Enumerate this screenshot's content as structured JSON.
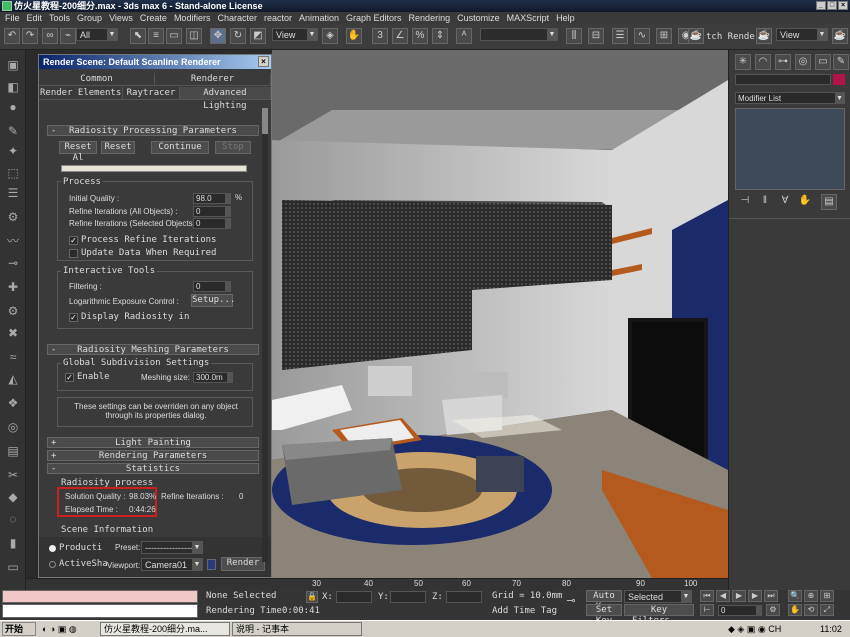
{
  "window": {
    "title": "仿火星教程-200细分.max - 3ds max 6 - Stand-alone License"
  },
  "menubar": {
    "items": [
      "File",
      "Edit",
      "Tools",
      "Group",
      "Views",
      "Create",
      "Modifiers",
      "Character",
      "reactor",
      "Animation",
      "Graph Editors",
      "Rendering",
      "Customize",
      "MAXScript",
      "Help"
    ]
  },
  "toolbar": {
    "selection_filter": "All",
    "ref_coord": "View",
    "render_label": "tch Render",
    "render_view": "View"
  },
  "dialog": {
    "title": "Render Scene: Default Scanline Renderer",
    "tabs_row1": [
      "Common",
      "Renderer"
    ],
    "tabs_row2": [
      "Render Elements",
      "Raytracer",
      "Advanced Lighting"
    ],
    "rollout_processing": "Radiosity Processing Parameters",
    "btn_reset_all": "Reset Al",
    "btn_reset": "Reset",
    "btn_continue": "Continue",
    "btn_stop": "Stop",
    "process_group": "Process",
    "initial_quality_label": "Initial Quality :",
    "initial_quality_value": "98.0",
    "initial_quality_unit": "%",
    "refine_all_label": "Refine Iterations (All Objects) :",
    "refine_all_value": "0",
    "refine_sel_label": "Refine Iterations (Selected Objects) :",
    "refine_sel_value": "0",
    "chk_process_refine": "Process Refine Iterations",
    "chk_update_data": "Update Data When Required",
    "interactive_group": "Interactive Tools",
    "filtering_label": "Filtering :",
    "filtering_value": "0",
    "log_exposure_label": "Logarithmic Exposure Control :",
    "setup_btn": "Setup...",
    "chk_display_radiosity": "Display Radiosity in",
    "rollout_meshing": "Radiosity Meshing Parameters",
    "global_subdiv": "Global Subdivision Settings",
    "chk_enable": "Enable",
    "meshing_size_label": "Meshing size:",
    "meshing_size_value": "300.0m",
    "override_note": "These settings can be overriden on any object through its properties dialog.",
    "rollout_light": "Light Painting",
    "rollout_rendering": "Rendering Parameters",
    "rollout_stats": "Statistics",
    "stats_group": "Radiosity process",
    "solution_quality_label": "Solution Quality :",
    "solution_quality_value": "98.03%",
    "refine_iter_label": "Refine Iterations :",
    "refine_iter_value": "0",
    "elapsed_label": "Elapsed Time :",
    "elapsed_value": "0:44:26",
    "scene_info": "Scene Information",
    "radio_production": "Producti",
    "radio_activeshade": "ActiveSha",
    "preset_label": "Preset:",
    "preset_value": "-------------------",
    "viewport_label": "Viewport:",
    "viewport_value": "Camera01",
    "render_btn": "Render"
  },
  "cmdpanel": {
    "modifier_list": "Modifier List"
  },
  "timeline": {
    "ticks": [
      "30",
      "40",
      "50",
      "60",
      "70",
      "80",
      "90",
      "100"
    ]
  },
  "status": {
    "selection": "None Selected",
    "render_time_label": "Rendering Time",
    "render_time_value": "0:00:41",
    "x_label": "X:",
    "y_label": "Y:",
    "z_label": "Z:",
    "grid": "Grid = 10.0mm",
    "add_time_tag": "Add Time Tag",
    "auto_key": "Auto Key",
    "set_key": "Set Key",
    "key_mode": "Selected",
    "key_filters": "Key Filters...",
    "frame": "0"
  },
  "taskbar": {
    "start": "开始",
    "task1": "仿火星教程-200细分.ma...",
    "task2": "说明 - 记事本",
    "clock": "11:02"
  },
  "colors": {
    "highlight_box": "#cc1f1f",
    "viewport_floor": "#8c8479",
    "rug": "#1a2a6a",
    "wood": "#b45a1e"
  }
}
